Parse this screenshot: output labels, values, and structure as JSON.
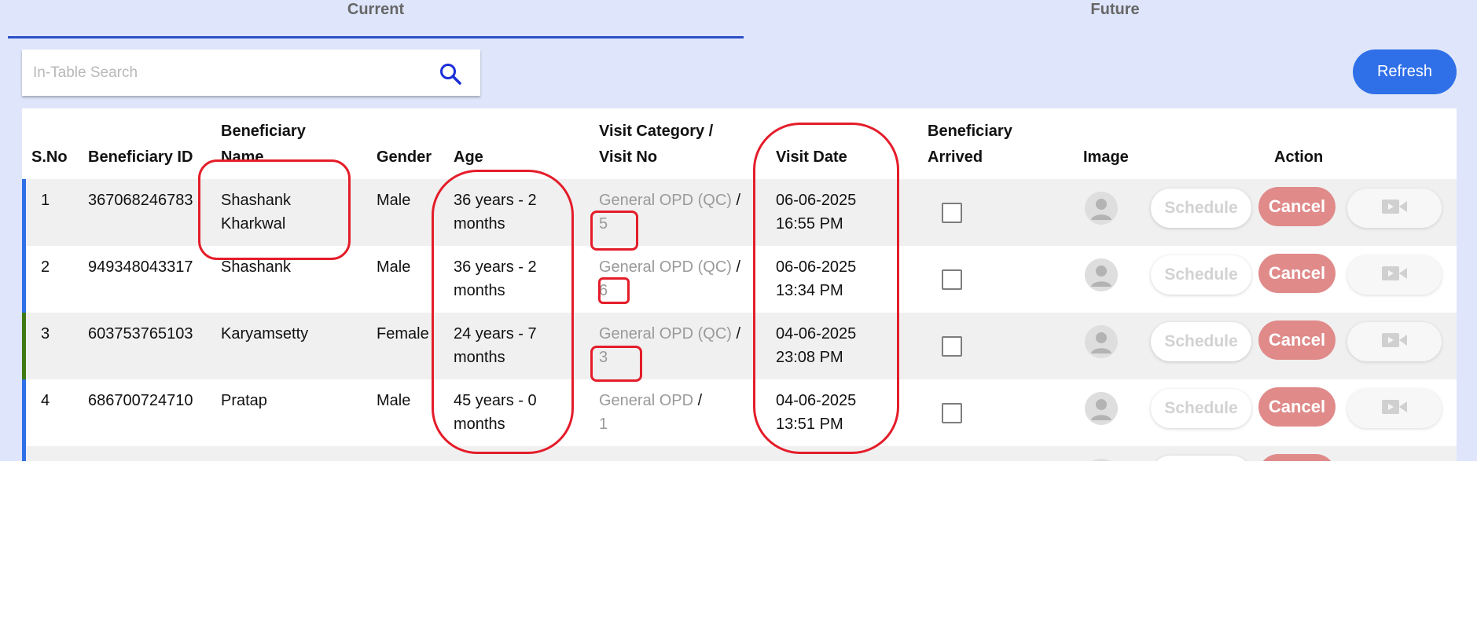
{
  "tabs": [
    {
      "label": "Current",
      "active": true
    },
    {
      "label": "Future",
      "active": false
    }
  ],
  "search": {
    "placeholder": "In-Table Search",
    "value": ""
  },
  "toolbar": {
    "refresh_label": "Refresh"
  },
  "table": {
    "headers": {
      "sno": "S.No",
      "beneficiary_id": "Beneficiary ID",
      "name_line1": "Beneficiary",
      "name_line2": "Name",
      "gender": "Gender",
      "age": "Age",
      "visit_cat_line1": "Visit Category /",
      "visit_cat_line2": "Visit No",
      "visit_date": "Visit Date",
      "arrived_line1": "Beneficiary",
      "arrived_line2": "Arrived",
      "image": "Image",
      "action": "Action"
    },
    "rows": [
      {
        "sno": "1",
        "id": "367068246783",
        "name1": "Shashank",
        "name2": "Kharkwal",
        "gender": "Male",
        "age1": "36 years - 2",
        "age2": "months",
        "category": "General OPD (QC)",
        "sep": " /",
        "visit_no": "5",
        "date": "06-06-2025",
        "time": "16:55 PM",
        "bar_color": "#2f6fe8"
      },
      {
        "sno": "2",
        "id": "949348043317",
        "name1": "Shashank",
        "name2": "",
        "gender": "Male",
        "age1": "36 years - 2",
        "age2": "months",
        "category": "General OPD (QC)",
        "sep": " /",
        "visit_no": "6",
        "date": "06-06-2025",
        "time": "13:34 PM",
        "bar_color": "#2f6fe8"
      },
      {
        "sno": "3",
        "id": "603753765103",
        "name1": "Karyamsetty",
        "name2": "",
        "gender": "Female",
        "age1": "24 years - 7",
        "age2": "months",
        "category": "General OPD (QC)",
        "sep": " /",
        "visit_no": "3",
        "date": "04-06-2025",
        "time": "23:08 PM",
        "bar_color": "#3f7a14"
      },
      {
        "sno": "4",
        "id": "686700724710",
        "name1": "Pratap",
        "name2": "",
        "gender": "Male",
        "age1": "45 years - 0",
        "age2": "months",
        "category": "General OPD",
        "sep": " /",
        "visit_no": "1",
        "date": "04-06-2025",
        "time": "13:51 PM",
        "bar_color": "#2f6fe8"
      }
    ],
    "action_labels": {
      "schedule": "Schedule",
      "cancel": "Cancel"
    }
  },
  "icons": {
    "search": "search-icon",
    "avatar": "avatar-placeholder-icon",
    "video": "video-call-icon"
  },
  "colors": {
    "accent": "#2f6fe8",
    "cancel": "#e08a8a",
    "annotation": "#e41d2a",
    "background": "#dfe6fb"
  }
}
